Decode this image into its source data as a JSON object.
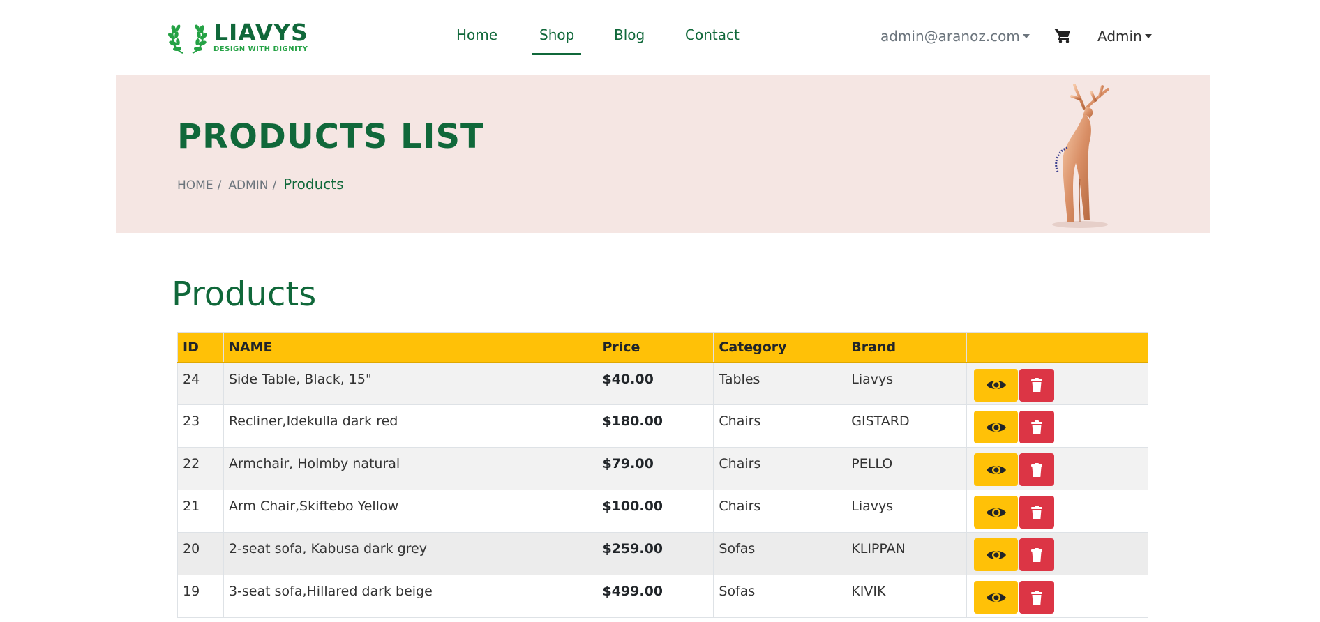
{
  "brand": {
    "name": "LIAVYS",
    "tagline": "DESIGN WITH DIGNITY"
  },
  "nav": {
    "items": [
      {
        "label": "Home"
      },
      {
        "label": "Shop",
        "active": true
      },
      {
        "label": "Blog"
      },
      {
        "label": "Contact"
      }
    ]
  },
  "user": {
    "email": "admin@aranoz.com",
    "role_menu": "Admin"
  },
  "banner": {
    "title": "PRODUCTS LIST",
    "breadcrumb": [
      "HOME",
      "ADMIN"
    ],
    "current": "Products"
  },
  "section_title": "Products",
  "table": {
    "headers": {
      "id": "ID",
      "name": "NAME",
      "price": "Price",
      "category": "Category",
      "brand": "Brand"
    },
    "rows": [
      {
        "id": "24",
        "name": "Side Table, Black, 15\"",
        "price": "$40.00",
        "category": "Tables",
        "brand": "Liavys"
      },
      {
        "id": "23",
        "name": "Recliner,Idekulla dark red",
        "price": "$180.00",
        "category": "Chairs",
        "brand": "GISTARD"
      },
      {
        "id": "22",
        "name": "Armchair, Holmby natural",
        "price": "$79.00",
        "category": "Chairs",
        "brand": "PELLO"
      },
      {
        "id": "21",
        "name": "Arm Chair,Skiftebo Yellow",
        "price": "$100.00",
        "category": "Chairs",
        "brand": "Liavys"
      },
      {
        "id": "20",
        "name": "2-seat sofa, Kabusa dark grey",
        "price": "$259.00",
        "category": "Sofas",
        "brand": "KLIPPAN"
      },
      {
        "id": "19",
        "name": "3-seat sofa,Hillared dark beige",
        "price": "$499.00",
        "category": "Sofas",
        "brand": "KIVIK"
      }
    ]
  },
  "colors": {
    "brand_green": "#10683a",
    "accent_yellow": "#ffc107",
    "danger_red": "#dc3545",
    "banner_bg": "#f5e6e3"
  },
  "icons": {
    "view": "eye-icon",
    "delete": "trash-icon",
    "cart": "cart-icon"
  }
}
